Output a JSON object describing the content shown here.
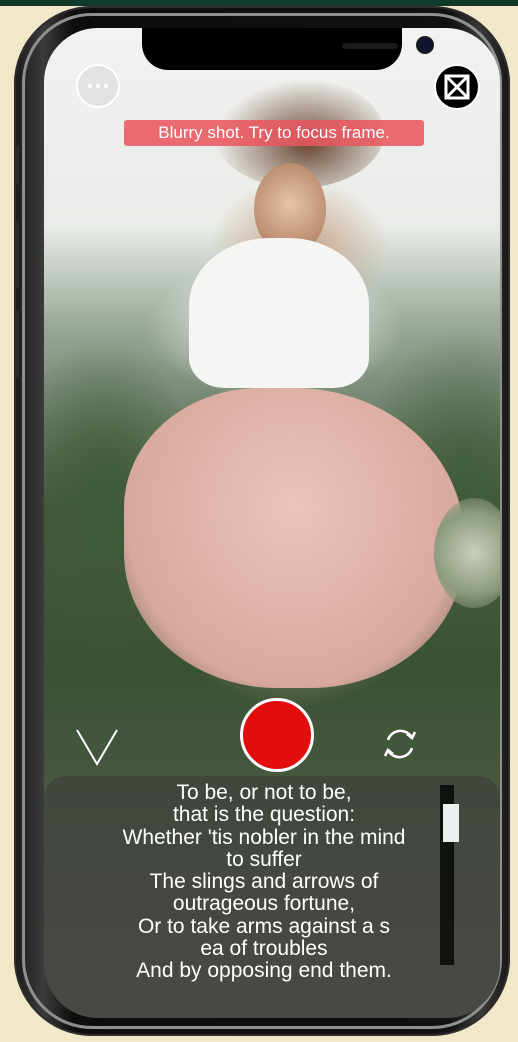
{
  "status": {
    "blur_warning": "Blurry shot. Try to focus frame."
  },
  "controls": {
    "menu_icon": "ellipsis-circle-icon",
    "close_icon": "close-square-icon",
    "confirm_icon": "chevron-down-icon",
    "record_icon": "record-button",
    "flip_icon": "rotate-camera-icon",
    "record_color": "#e40d0d"
  },
  "teleprompter": {
    "lines": [
      "To be, or not to be,",
      "that is the question:",
      "Whether 'tis nobler in the mind",
      "to suffer",
      "The slings and arrows of",
      "outrageous fortune,",
      "Or to take arms against a s",
      "ea of troubles",
      "And by opposing end them."
    ],
    "scroll_position": 0.1
  }
}
